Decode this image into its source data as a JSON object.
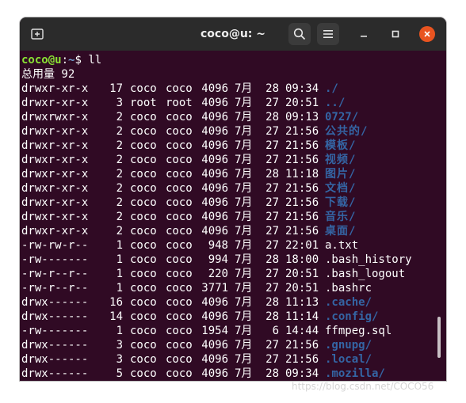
{
  "window": {
    "title": "coco@u: ~"
  },
  "terminal": {
    "prompt": {
      "user_host": "coco@u",
      "colon": ":",
      "path": "~",
      "symbol": "$",
      "command": " ll"
    },
    "total": "总用量 92",
    "rows": [
      {
        "perm": "drwxr-xr-x",
        "links": "17",
        "user": "coco",
        "group": "coco",
        "size": "4096",
        "month": "7月",
        "day": "28",
        "time": "09:34",
        "name": "./",
        "type": "dir"
      },
      {
        "perm": "drwxr-xr-x",
        "links": "3",
        "user": "root",
        "group": "root",
        "size": "4096",
        "month": "7月",
        "day": "27",
        "time": "20:51",
        "name": "../",
        "type": "dir"
      },
      {
        "perm": "drwxrwxr-x",
        "links": "2",
        "user": "coco",
        "group": "coco",
        "size": "4096",
        "month": "7月",
        "day": "28",
        "time": "09:13",
        "name": "0727/",
        "type": "dir"
      },
      {
        "perm": "drwxr-xr-x",
        "links": "2",
        "user": "coco",
        "group": "coco",
        "size": "4096",
        "month": "7月",
        "day": "27",
        "time": "21:56",
        "name": "公共的/",
        "type": "dir-cjk"
      },
      {
        "perm": "drwxr-xr-x",
        "links": "2",
        "user": "coco",
        "group": "coco",
        "size": "4096",
        "month": "7月",
        "day": "27",
        "time": "21:56",
        "name": "模板/",
        "type": "dir-cjk"
      },
      {
        "perm": "drwxr-xr-x",
        "links": "2",
        "user": "coco",
        "group": "coco",
        "size": "4096",
        "month": "7月",
        "day": "27",
        "time": "21:56",
        "name": "视频/",
        "type": "dir-cjk"
      },
      {
        "perm": "drwxr-xr-x",
        "links": "2",
        "user": "coco",
        "group": "coco",
        "size": "4096",
        "month": "7月",
        "day": "28",
        "time": "11:18",
        "name": "图片/",
        "type": "dir-cjk"
      },
      {
        "perm": "drwxr-xr-x",
        "links": "2",
        "user": "coco",
        "group": "coco",
        "size": "4096",
        "month": "7月",
        "day": "27",
        "time": "21:56",
        "name": "文档/",
        "type": "dir-cjk"
      },
      {
        "perm": "drwxr-xr-x",
        "links": "2",
        "user": "coco",
        "group": "coco",
        "size": "4096",
        "month": "7月",
        "day": "27",
        "time": "21:56",
        "name": "下载/",
        "type": "dir-cjk"
      },
      {
        "perm": "drwxr-xr-x",
        "links": "2",
        "user": "coco",
        "group": "coco",
        "size": "4096",
        "month": "7月",
        "day": "27",
        "time": "21:56",
        "name": "音乐/",
        "type": "dir-cjk"
      },
      {
        "perm": "drwxr-xr-x",
        "links": "2",
        "user": "coco",
        "group": "coco",
        "size": "4096",
        "month": "7月",
        "day": "27",
        "time": "21:56",
        "name": "桌面/",
        "type": "dir-cjk"
      },
      {
        "perm": "-rw-rw-r--",
        "links": "1",
        "user": "coco",
        "group": "coco",
        "size": "948",
        "month": "7月",
        "day": "27",
        "time": "22:01",
        "name": "a.txt",
        "type": "file"
      },
      {
        "perm": "-rw-------",
        "links": "1",
        "user": "coco",
        "group": "coco",
        "size": "994",
        "month": "7月",
        "day": "28",
        "time": "18:00",
        "name": ".bash_history",
        "type": "file"
      },
      {
        "perm": "-rw-r--r--",
        "links": "1",
        "user": "coco",
        "group": "coco",
        "size": "220",
        "month": "7月",
        "day": "27",
        "time": "20:51",
        "name": ".bash_logout",
        "type": "file"
      },
      {
        "perm": "-rw-r--r--",
        "links": "1",
        "user": "coco",
        "group": "coco",
        "size": "3771",
        "month": "7月",
        "day": "27",
        "time": "20:51",
        "name": ".bashrc",
        "type": "file"
      },
      {
        "perm": "drwx------",
        "links": "16",
        "user": "coco",
        "group": "coco",
        "size": "4096",
        "month": "7月",
        "day": "28",
        "time": "11:13",
        "name": ".cache/",
        "type": "dir"
      },
      {
        "perm": "drwx------",
        "links": "14",
        "user": "coco",
        "group": "coco",
        "size": "4096",
        "month": "7月",
        "day": "28",
        "time": "11:14",
        "name": ".config/",
        "type": "dir"
      },
      {
        "perm": "-rw-------",
        "links": "1",
        "user": "coco",
        "group": "coco",
        "size": "1954",
        "month": "7月",
        "day": "6",
        "time": "14:44",
        "name": "ffmpeg.sql",
        "type": "file"
      },
      {
        "perm": "drwx------",
        "links": "3",
        "user": "coco",
        "group": "coco",
        "size": "4096",
        "month": "7月",
        "day": "27",
        "time": "21:56",
        "name": ".gnupg/",
        "type": "dir"
      },
      {
        "perm": "drwx------",
        "links": "3",
        "user": "coco",
        "group": "coco",
        "size": "4096",
        "month": "7月",
        "day": "27",
        "time": "21:56",
        "name": ".local/",
        "type": "dir"
      },
      {
        "perm": "drwx------",
        "links": "5",
        "user": "coco",
        "group": "coco",
        "size": "4096",
        "month": "7月",
        "day": "28",
        "time": "09:34",
        "name": ".mozilla/",
        "type": "dir"
      }
    ]
  },
  "watermark": "https://blog.csdn.net/COCO56",
  "colors": {
    "terminal_bg": "#300a24",
    "titlebar_bg": "#2b2b2b",
    "dir": "#3465a4",
    "prompt_user": "#8ae234",
    "prompt_path": "#729fcf",
    "close": "#e95420"
  },
  "icons": {
    "new_tab": "new-tab-icon",
    "search": "search-icon",
    "menu": "hamburger-menu-icon",
    "minimize": "minimize-icon",
    "maximize": "maximize-icon",
    "close": "close-icon"
  }
}
